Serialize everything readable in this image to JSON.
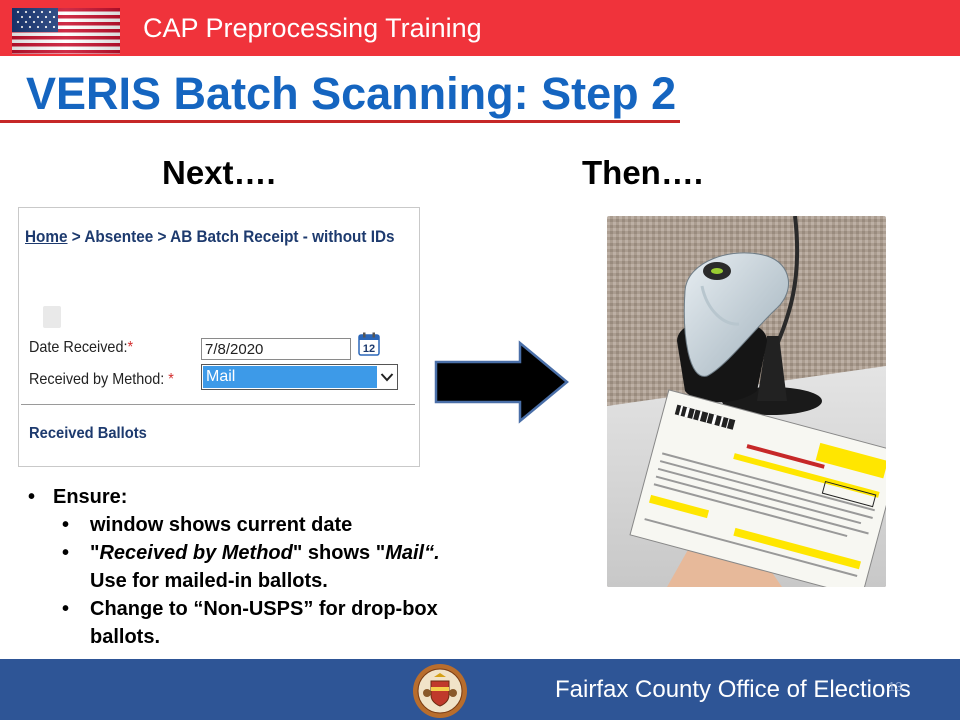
{
  "header": {
    "title": "CAP Preprocessing Training",
    "flag_icon": "us-flag-icon",
    "bar_color": "#f0333b"
  },
  "slide": {
    "title": "VERIS Batch Scanning:  Step 2",
    "title_color": "#1565c0",
    "next_label": "Next….",
    "then_label": "Then…."
  },
  "screenshot": {
    "breadcrumb": {
      "home": "Home",
      "sep1": " > ",
      "absentee": "Absentee",
      "sep2": " > ",
      "page": "AB Batch Receipt - without IDs"
    },
    "date_received": {
      "label": "Date Received:",
      "required_mark": "*",
      "value": "7/8/2020",
      "calendar_day": "12"
    },
    "received_by_method": {
      "label": "Received by Method: ",
      "required_mark": "*",
      "value": "Mail"
    },
    "section_title": "Received Ballots"
  },
  "bullets": {
    "main": "Ensure:",
    "item1": "window shows current date",
    "item2_q1": "\"",
    "item2_em1": "Received by Method",
    "item2_mid": "\" shows \"",
    "item2_em2": "Mail“.",
    "item2_line2": "Use for mailed-in ballots.",
    "item3_line1": "Change to “Non-USPS” for drop-box",
    "item3_line2": "ballots."
  },
  "footer": {
    "text": "Fairfax County Office of Elections",
    "page_number": "13",
    "seal_icon": "fairfax-county-seal-icon",
    "bar_color": "#2e5596"
  }
}
